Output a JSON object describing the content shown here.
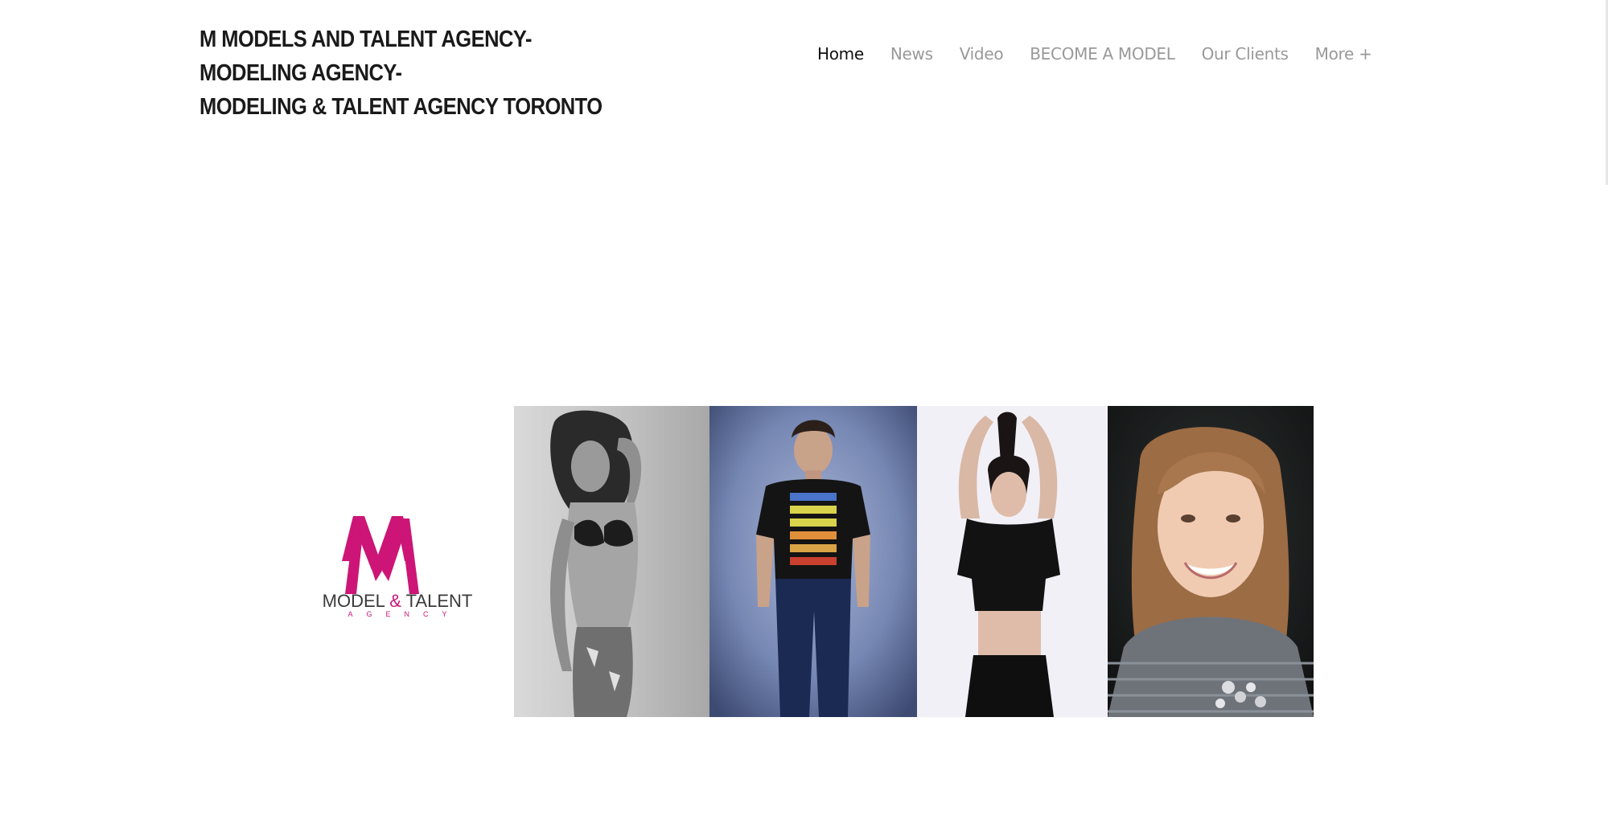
{
  "site": {
    "title_line1": "M MODELS AND TALENT AGENCY-MODELING AGENCY-",
    "title_line2": "MODELING & TALENT AGENCY TORONTO"
  },
  "nav": {
    "items": [
      {
        "label": "Home",
        "active": true
      },
      {
        "label": "News",
        "active": false
      },
      {
        "label": "Video",
        "active": false
      },
      {
        "label": "BECOME A MODEL",
        "active": false
      },
      {
        "label": "Our Clients",
        "active": false
      },
      {
        "label": "More +",
        "active": false
      }
    ]
  },
  "hero": {
    "logo": {
      "letter": "M",
      "text_part1": "MODEL",
      "text_amp": "&",
      "text_part2": "TALENT",
      "subtitle": "AGENCY"
    },
    "photos": [
      {
        "icon": "model-photo-woman-lingerie"
      },
      {
        "icon": "model-photo-man-tshirt"
      },
      {
        "icon": "model-photo-woman-black-top"
      },
      {
        "icon": "model-photo-girl-portrait"
      }
    ]
  },
  "colors": {
    "brand_magenta": "#cc1577",
    "text_dark": "#1a1a1a",
    "nav_inactive": "#999999"
  }
}
